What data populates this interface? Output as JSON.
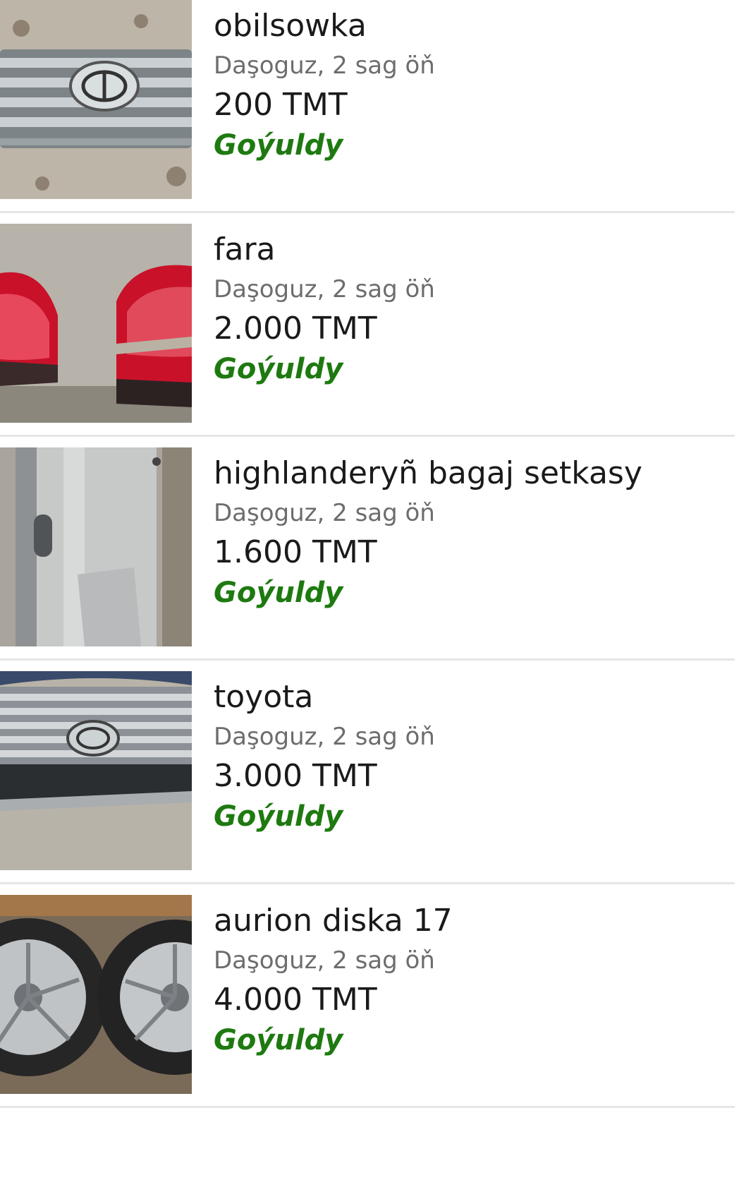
{
  "listings": [
    {
      "title": "obilsowka",
      "location_time": "Daşoguz, 2 sag öň",
      "price": "200 TMT",
      "status": "Goýuldy",
      "thumbnail": "car-grille-toyota"
    },
    {
      "title": "fara",
      "location_time": "Daşoguz, 2 sag öň",
      "price": "2.000 TMT",
      "status": "Goýuldy",
      "thumbnail": "tail-lights"
    },
    {
      "title": "highlanderyñ bagaj setkasy",
      "location_time": "Daşoguz, 2 sag öň",
      "price": "1.600 TMT",
      "status": "Goýuldy",
      "thumbnail": "cargo-cover"
    },
    {
      "title": "toyota",
      "location_time": "Daşoguz, 2 sag öň",
      "price": "3.000 TMT",
      "status": "Goýuldy",
      "thumbnail": "front-grille-bumper"
    },
    {
      "title": "aurion diska 17",
      "location_time": "Daşoguz, 2 sag öň",
      "price": "4.000 TMT",
      "status": "Goýuldy",
      "thumbnail": "alloy-wheels"
    }
  ],
  "colors": {
    "status_green": "#1e7a10",
    "meta_gray": "#6d6d6d",
    "divider": "#e6e6e6"
  }
}
